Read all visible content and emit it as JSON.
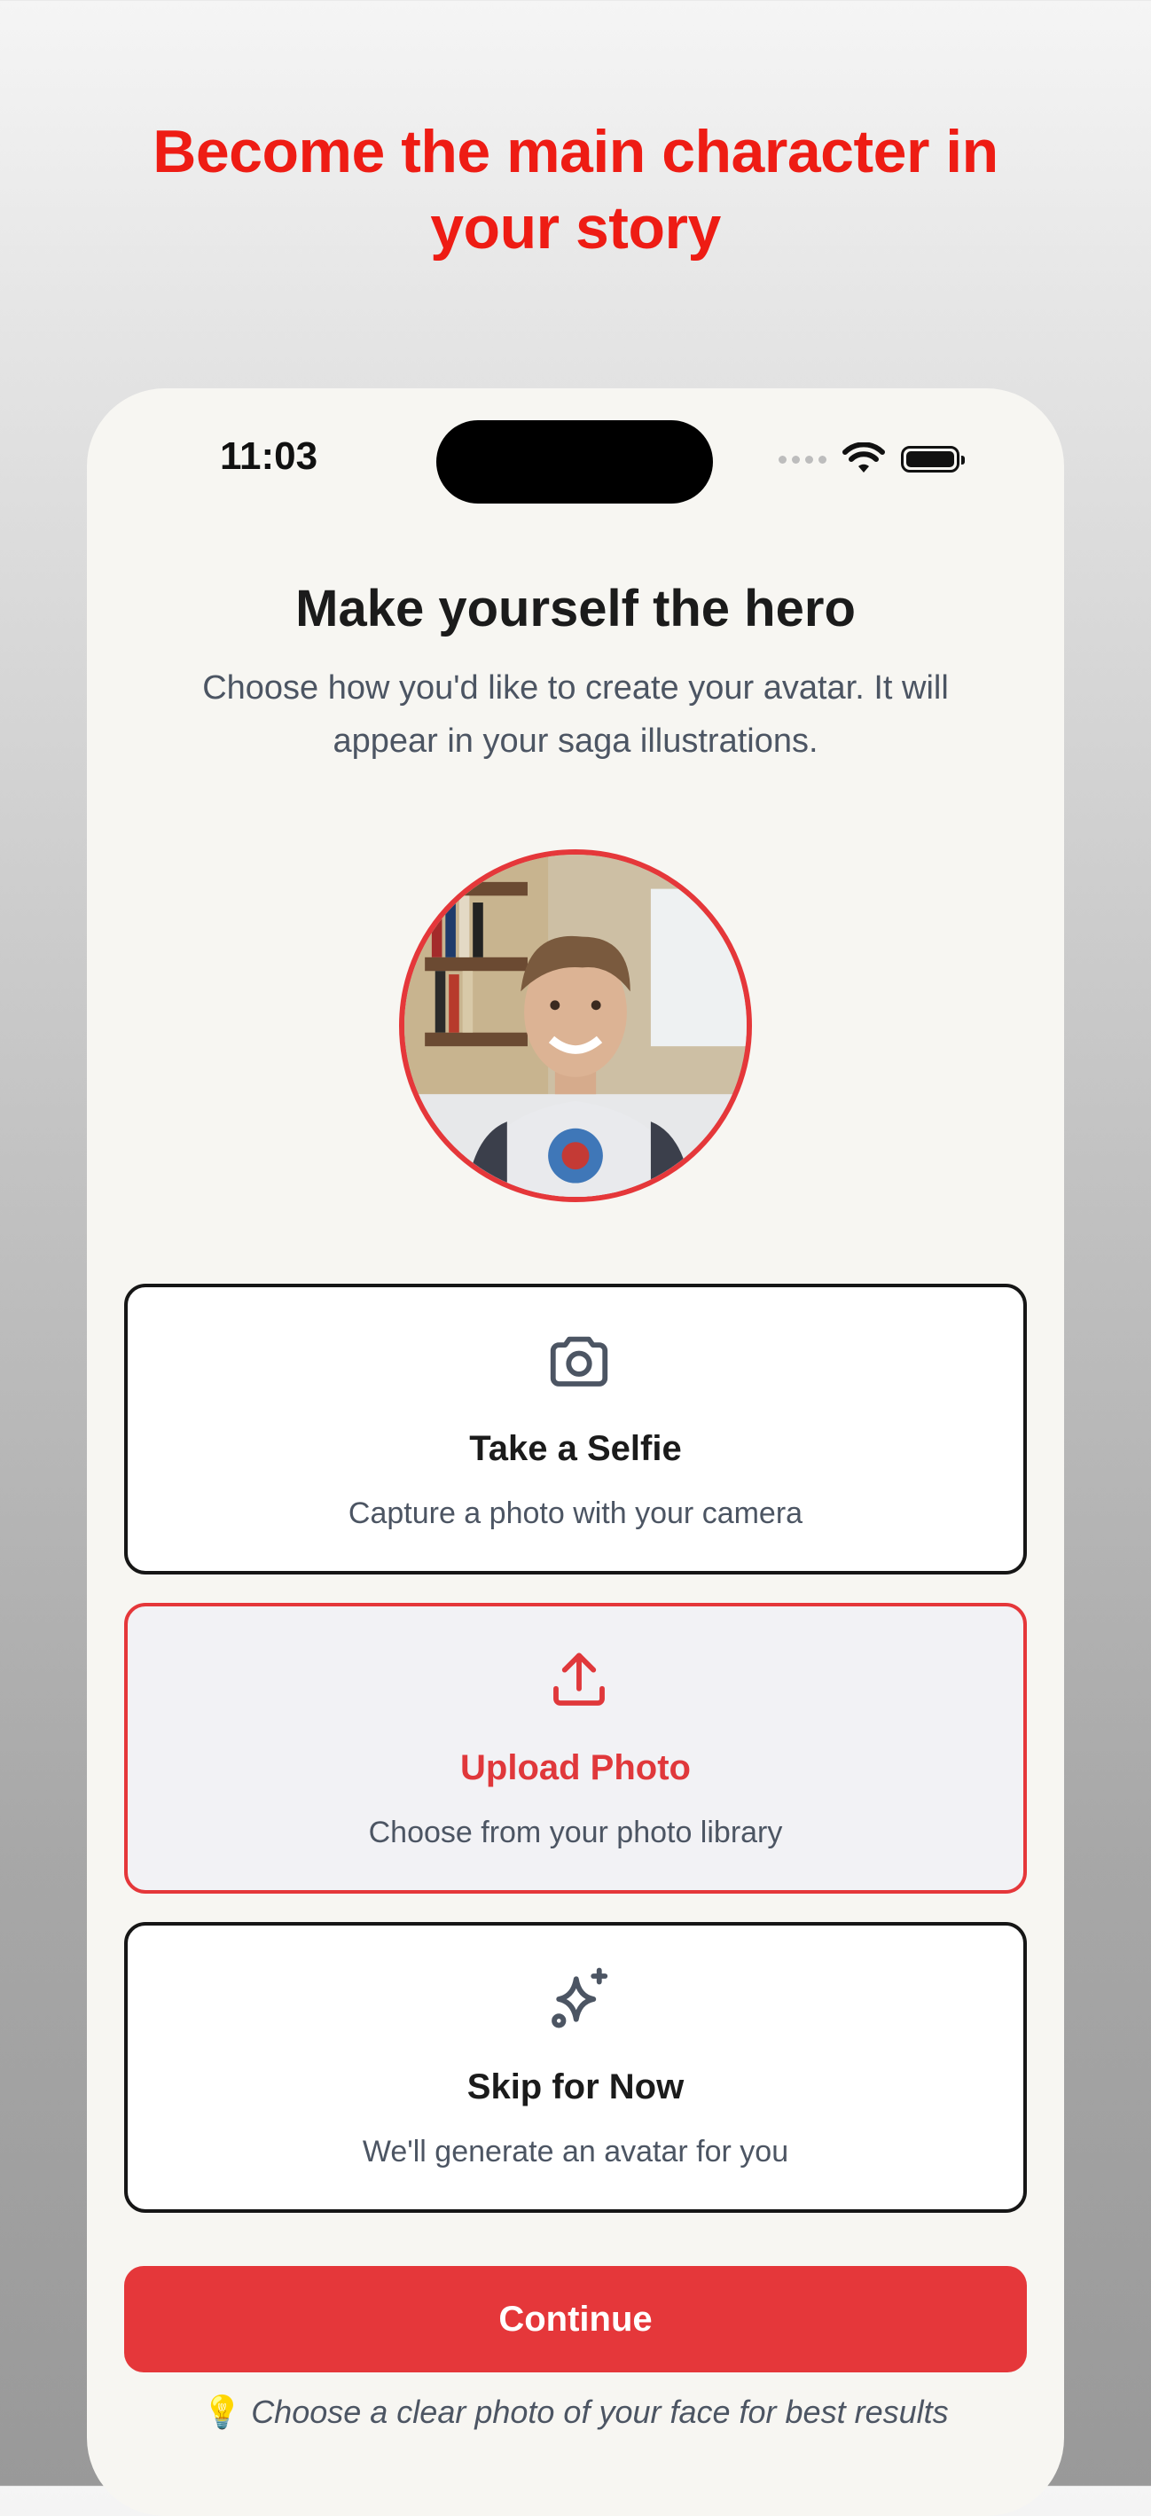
{
  "headline": "Become the main character in your story",
  "status_bar": {
    "time": "11:03"
  },
  "screen": {
    "title": "Make yourself the hero",
    "subtitle": "Choose how you'd like to create your avatar. It will appear in your saga illustrations."
  },
  "options": [
    {
      "icon": "camera-icon",
      "label": "Take a Selfie",
      "desc": "Capture a photo with your camera",
      "selected": false
    },
    {
      "icon": "upload-icon",
      "label": "Upload Photo",
      "desc": "Choose from your photo library",
      "selected": true
    },
    {
      "icon": "sparkles-icon",
      "label": "Skip for Now",
      "desc": "We'll generate an avatar for you",
      "selected": false
    }
  ],
  "continue_label": "Continue",
  "tip": {
    "icon": "lightbulb-icon",
    "text": "Choose a clear photo of your face for best results"
  },
  "colors": {
    "accent": "#e5373a",
    "headline": "#ee1c14",
    "background": "#f7f6f2"
  }
}
